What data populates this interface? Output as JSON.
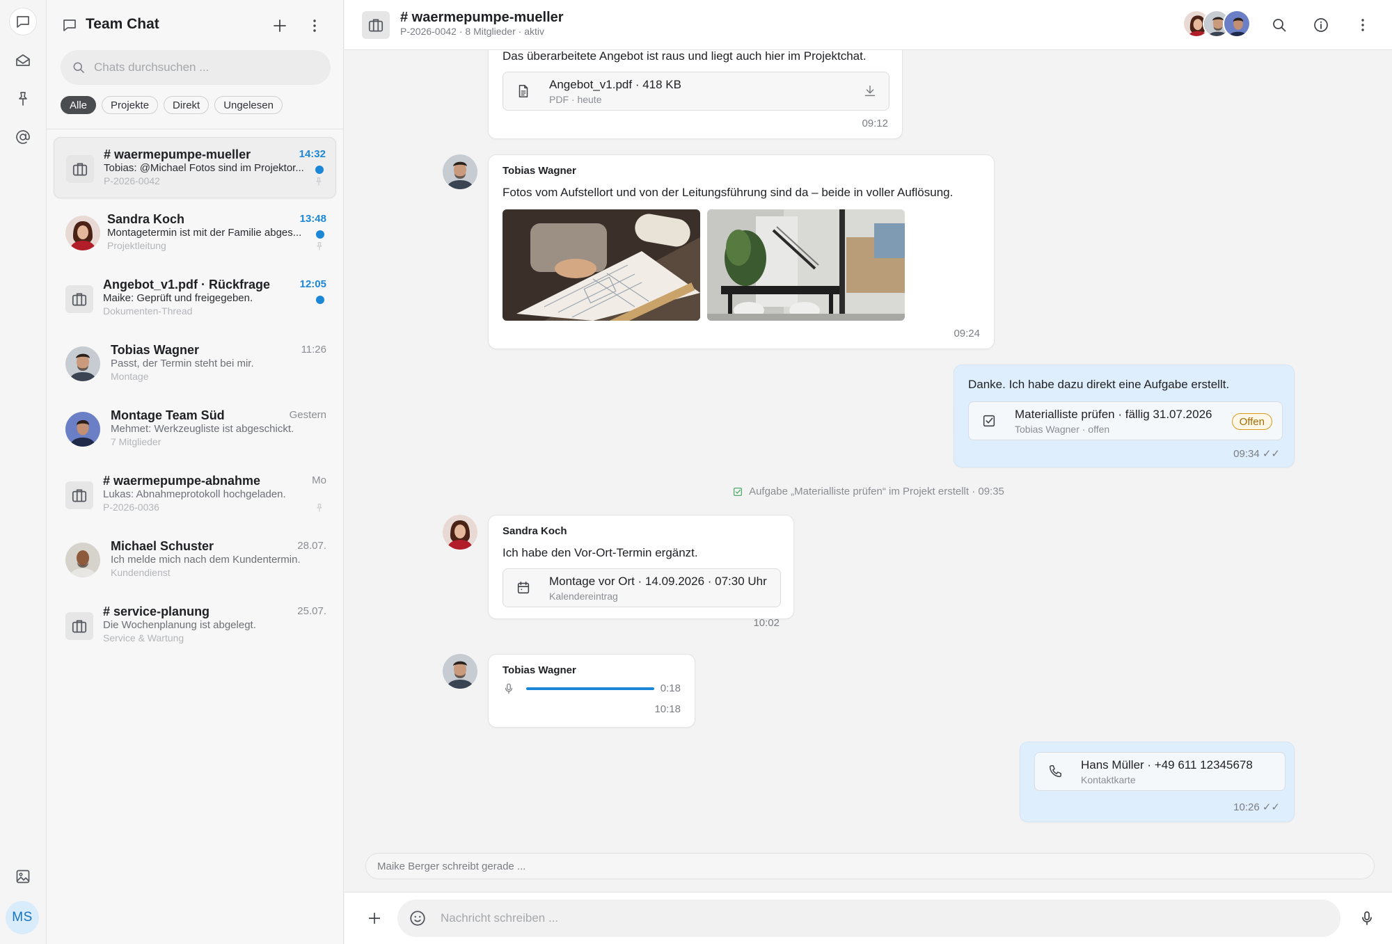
{
  "rail": {
    "items": [
      "chat-icon",
      "inbox-icon",
      "pin-icon",
      "mention-icon"
    ],
    "bottom_icon": "image-icon",
    "user_initials": "MS"
  },
  "sidebar": {
    "title": "Team Chat",
    "search_placeholder": "Chats durchsuchen ...",
    "filters": [
      "Alle",
      "Projekte",
      "Direkt",
      "Ungelesen"
    ],
    "active_filter": "Alle",
    "chats": [
      {
        "name": "# waermepumpe-mueller",
        "message": "Tobias: @Michael Fotos sind im Projektor...",
        "sub": "P-2026-0042",
        "time": "14:32",
        "unread": true,
        "pinned": true,
        "type": "project",
        "selected": true
      },
      {
        "name": "Sandra Koch",
        "message": "Montagetermin ist mit der Familie abges...",
        "sub": "Projektleitung",
        "time": "13:48",
        "unread": true,
        "pinned": true,
        "type": "person"
      },
      {
        "name": "Angebot_v1.pdf · Rückfrage",
        "message": "Maike: Geprüft und freigegeben.",
        "sub": "Dokumenten-Thread",
        "time": "12:05",
        "unread": true,
        "pinned": false,
        "type": "project"
      },
      {
        "name": "Tobias Wagner",
        "message": "Passt, der Termin steht bei mir.",
        "sub": "Montage",
        "time": "11:26",
        "unread": false,
        "pinned": false,
        "type": "person"
      },
      {
        "name": "Montage Team Süd",
        "message": "Mehmet: Werkzeugliste ist abgeschickt.",
        "sub": "7 Mitglieder",
        "time": "Gestern",
        "unread": false,
        "pinned": false,
        "type": "person"
      },
      {
        "name": "# waermepumpe-abnahme",
        "message": "Lukas: Abnahmeprotokoll hochgeladen.",
        "sub": "P-2026-0036",
        "time": "Mo",
        "unread": false,
        "pinned": true,
        "type": "project"
      },
      {
        "name": "Michael Schuster",
        "message": "Ich melde mich nach dem Kundentermin.",
        "sub": "Kundendienst",
        "time": "28.07.",
        "unread": false,
        "pinned": false,
        "type": "person"
      },
      {
        "name": "# service-planung",
        "message": "Die Wochenplanung ist abgelegt.",
        "sub": "Service & Wartung",
        "time": "25.07.",
        "unread": false,
        "pinned": false,
        "type": "project"
      }
    ]
  },
  "header": {
    "title": "# waermepumpe-mueller",
    "subtitle": "P-2026-0042 · 8 Mitglieder · aktiv"
  },
  "messages": {
    "m1": {
      "text": "Das überarbeitete Angebot ist raus und liegt auch hier im Projektchat.",
      "attachment_title": "Angebot_v1.pdf · 418 KB",
      "attachment_sub": "PDF · heute",
      "time": "09:12"
    },
    "m2": {
      "sender": "Tobias Wagner",
      "text": "Fotos vom Aufstellort und von der Leitungsführung sind da – beide in voller Auflösung.",
      "time": "09:24"
    },
    "m3": {
      "text": "Danke. Ich habe dazu direkt eine Aufgabe erstellt.",
      "task_title": "Materialliste prüfen · fällig 31.07.2026",
      "task_sub": "Tobias Wagner · offen",
      "task_status": "Offen",
      "time": "09:34 ✓✓"
    },
    "system": "Aufgabe „Materialliste prüfen“ im Projekt erstellt · 09:35",
    "m4": {
      "sender": "Sandra Koch",
      "text": "Ich habe den Vor-Ort-Termin ergänzt.",
      "event_title": "Montage vor Ort · 14.09.2026 · 07:30 Uhr",
      "event_sub": "Kalendereintrag",
      "time": "10:02"
    },
    "m5": {
      "sender": "Tobias Wagner",
      "duration": "0:18",
      "time": "10:18"
    },
    "m6": {
      "contact_title": "Hans Müller · +49 611 12345678",
      "contact_sub": "Kontaktkarte",
      "time": "10:26 ✓✓"
    }
  },
  "typing": "Maike Berger schreibt gerade ...",
  "composer": {
    "placeholder": "Nachricht schreiben ..."
  },
  "colors": {
    "accent": "#1b87d6",
    "outgoing_bubble": "#deeefc",
    "task_badge": "#d89a1c"
  }
}
